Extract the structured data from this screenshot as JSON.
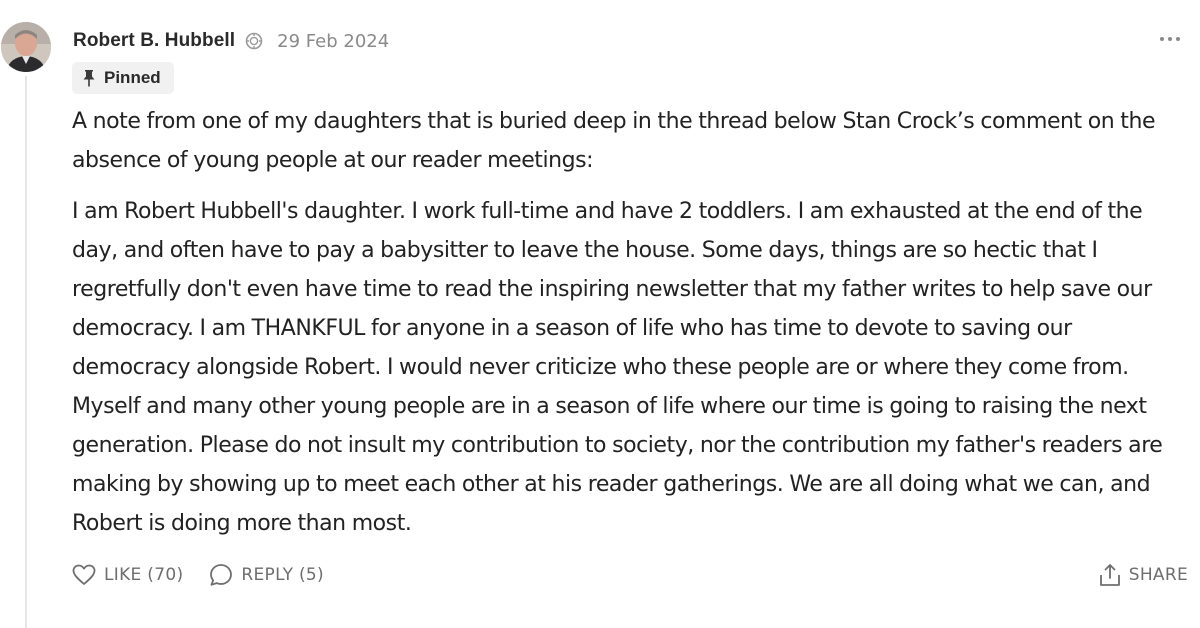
{
  "author": {
    "name": "Robert B. Hubbell",
    "avatar_icon": "avatar-photo",
    "badge_icon": "subscriber-badge-icon"
  },
  "comment": {
    "date": "29 Feb 2024",
    "pinned_label": "Pinned",
    "paragraphs": [
      "A note from one of my daughters that is buried deep in the thread below Stan Crock’s comment on the absence of young people at our reader meetings:",
      "I am Robert Hubbell's daughter. I work full-time and have 2 toddlers. I am exhausted at the end of the day, and often have to pay a babysitter to leave the house. Some days, things are so hectic that I regretfully don't even have time to read the inspiring newsletter that my father writes to help save our democracy. I am THANKFUL for anyone in a season of life who has time to devote to saving our democracy alongside Robert. I would never criticize who these people are or where they come from. Myself and many other young people are in a season of life where our time is going to raising the next generation. Please do not insult my contribution to society, nor the contribution my father's readers are making by showing up to meet each other at his reader gatherings. We are all doing what we can, and Robert is doing more than most."
    ]
  },
  "actions": {
    "like_label": "LIKE (70)",
    "reply_label": "REPLY (5)",
    "share_label": "SHARE"
  },
  "colors": {
    "text": "#222222",
    "muted": "#6e6e6e",
    "date": "#8a8a8a",
    "pinned_bg": "#f1f1f1",
    "thread_line": "#e6e6e6"
  }
}
